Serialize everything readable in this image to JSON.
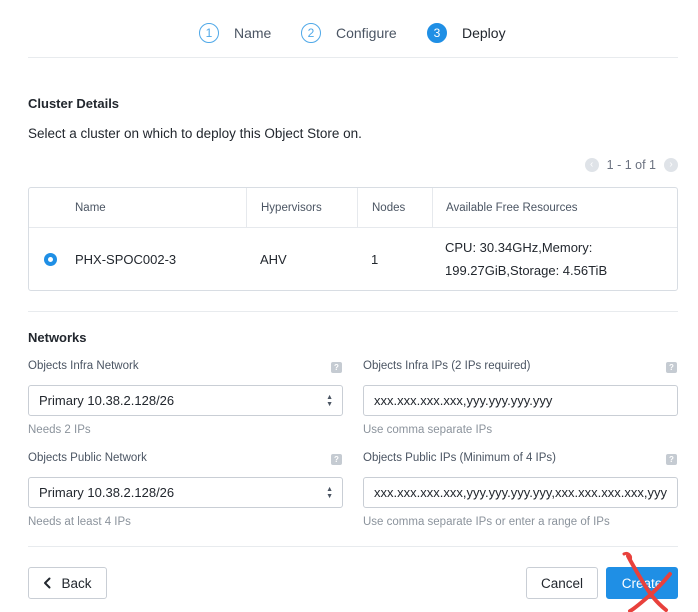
{
  "stepper": {
    "steps": [
      {
        "number": "1",
        "label": "Name"
      },
      {
        "number": "2",
        "label": "Configure"
      },
      {
        "number": "3",
        "label": "Deploy"
      }
    ]
  },
  "cluster_details": {
    "title": "Cluster Details",
    "description": "Select a cluster on which to deploy this Object Store on.",
    "pagination": "1 - 1 of 1",
    "columns": [
      "Name",
      "Hypervisors",
      "Nodes",
      "Available Free Resources"
    ],
    "rows": [
      {
        "name": "PHX-SPOC002-3",
        "hypervisor": "AHV",
        "nodes": "1",
        "resources_line1": "CPU: 30.34GHz,Memory:",
        "resources_line2": "199.27GiB,Storage: 4.56TiB"
      }
    ]
  },
  "networks": {
    "title": "Networks",
    "infra_network": {
      "label": "Objects Infra Network",
      "value": "Primary  10.38.2.128/26",
      "hint": "Needs 2 IPs"
    },
    "infra_ips": {
      "label": "Objects Infra IPs (2 IPs required)",
      "value": "xxx.xxx.xxx.xxx,yyy.yyy.yyy.yyy",
      "hint": "Use comma separate IPs"
    },
    "public_network": {
      "label": "Objects Public Network",
      "value": "Primary  10.38.2.128/26",
      "hint": "Needs at least 4 IPs"
    },
    "public_ips": {
      "label": "Objects Public IPs (Minimum of 4 IPs)",
      "value": "xxx.xxx.xxx.xxx,yyy.yyy.yyy.yyy,xxx.xxx.xxx.xxx,yyy",
      "hint": "Use comma separate IPs or enter a range of IPs"
    },
    "help_glyph": "?"
  },
  "footer": {
    "back_label": "Back",
    "cancel_label": "Cancel",
    "create_label": "Create"
  },
  "colors": {
    "accent": "#1f8fe5",
    "annotation": "#e8413c"
  }
}
